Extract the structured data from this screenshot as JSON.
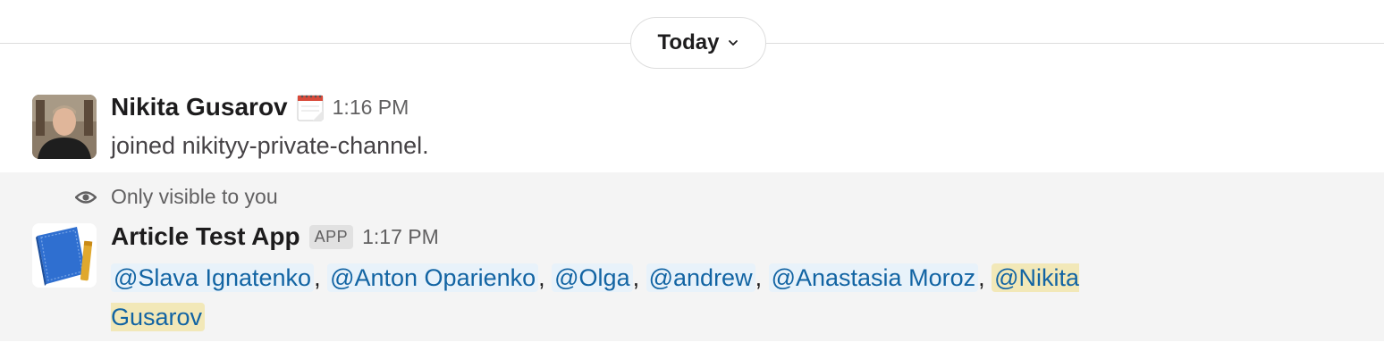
{
  "date_divider": {
    "label": "Today"
  },
  "messages": [
    {
      "author": "Nikita Gusarov",
      "status_emoji": "calendar-icon",
      "time": "1:16 PM",
      "text": "joined nikityy-private-channel."
    },
    {
      "visibility_note": "Only visible to you",
      "author": "Article Test App",
      "badge": "APP",
      "time": "1:17 PM",
      "mentions": [
        {
          "label": "@Slava Ignatenko",
          "sep": ", "
        },
        {
          "label": "@Anton Oparienko",
          "sep": ", "
        },
        {
          "label": "@Olga",
          "sep": ", "
        },
        {
          "label": "@andrew",
          "sep": ", "
        },
        {
          "label": "@Anastasia Moroz",
          "sep": ", "
        },
        {
          "label": "@Nikita Gusarov",
          "sep": ""
        }
      ]
    }
  ],
  "colors": {
    "mention_text": "#1264a3",
    "mention_bg": "#e8f2fa",
    "self_mention_bg": "#f2e8b8",
    "ephemeral_bg": "#f4f4f4"
  }
}
